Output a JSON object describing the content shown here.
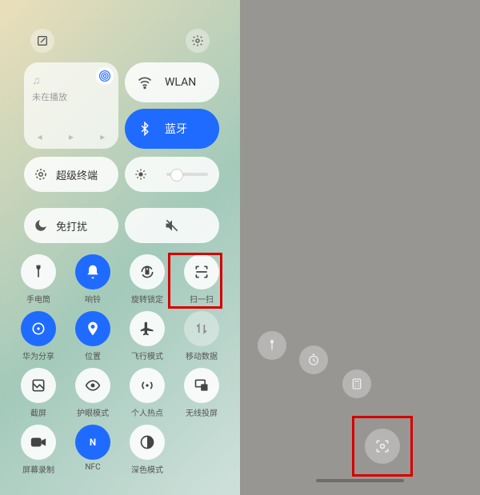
{
  "media": {
    "status": "未在播放"
  },
  "pills": {
    "wlan": "WLAN",
    "bt": "蓝牙",
    "superdev": "超级终端",
    "dnd": "免打扰"
  },
  "grid": [
    [
      {
        "name": "flashlight",
        "label": "手电筒",
        "style": "c-w",
        "icon": "flash"
      },
      {
        "name": "ring",
        "label": "响铃",
        "style": "c-b",
        "icon": "bell"
      },
      {
        "name": "rotation-lock",
        "label": "旋转锁定",
        "style": "c-w",
        "icon": "rotlock"
      },
      {
        "name": "scan",
        "label": "扫一扫",
        "style": "c-w",
        "icon": "scan"
      }
    ],
    [
      {
        "name": "huawei-share",
        "label": "华为分享",
        "style": "c-b",
        "icon": "share"
      },
      {
        "name": "location",
        "label": "位置",
        "style": "c-b",
        "icon": "pin"
      },
      {
        "name": "airplane",
        "label": "飞行模式",
        "style": "c-w",
        "icon": "plane"
      },
      {
        "name": "mobile-data",
        "label": "移动数据",
        "style": "c-t",
        "icon": "data"
      }
    ],
    [
      {
        "name": "screenshot",
        "label": "截屏",
        "style": "c-w",
        "icon": "shot"
      },
      {
        "name": "eye-comfort",
        "label": "护眼模式",
        "style": "c-w",
        "icon": "eye"
      },
      {
        "name": "hotspot",
        "label": "个人热点",
        "style": "c-w",
        "icon": "hotspot"
      },
      {
        "name": "cast",
        "label": "无线投屏",
        "style": "c-w",
        "icon": "cast"
      }
    ],
    [
      {
        "name": "screen-record",
        "label": "屏幕录制",
        "style": "c-w",
        "icon": "rec"
      },
      {
        "name": "nfc",
        "label": "NFC",
        "style": "c-b",
        "icon": "nfc"
      },
      {
        "name": "dark-mode",
        "label": "深色模式",
        "style": "c-w",
        "icon": "dark"
      }
    ]
  ]
}
